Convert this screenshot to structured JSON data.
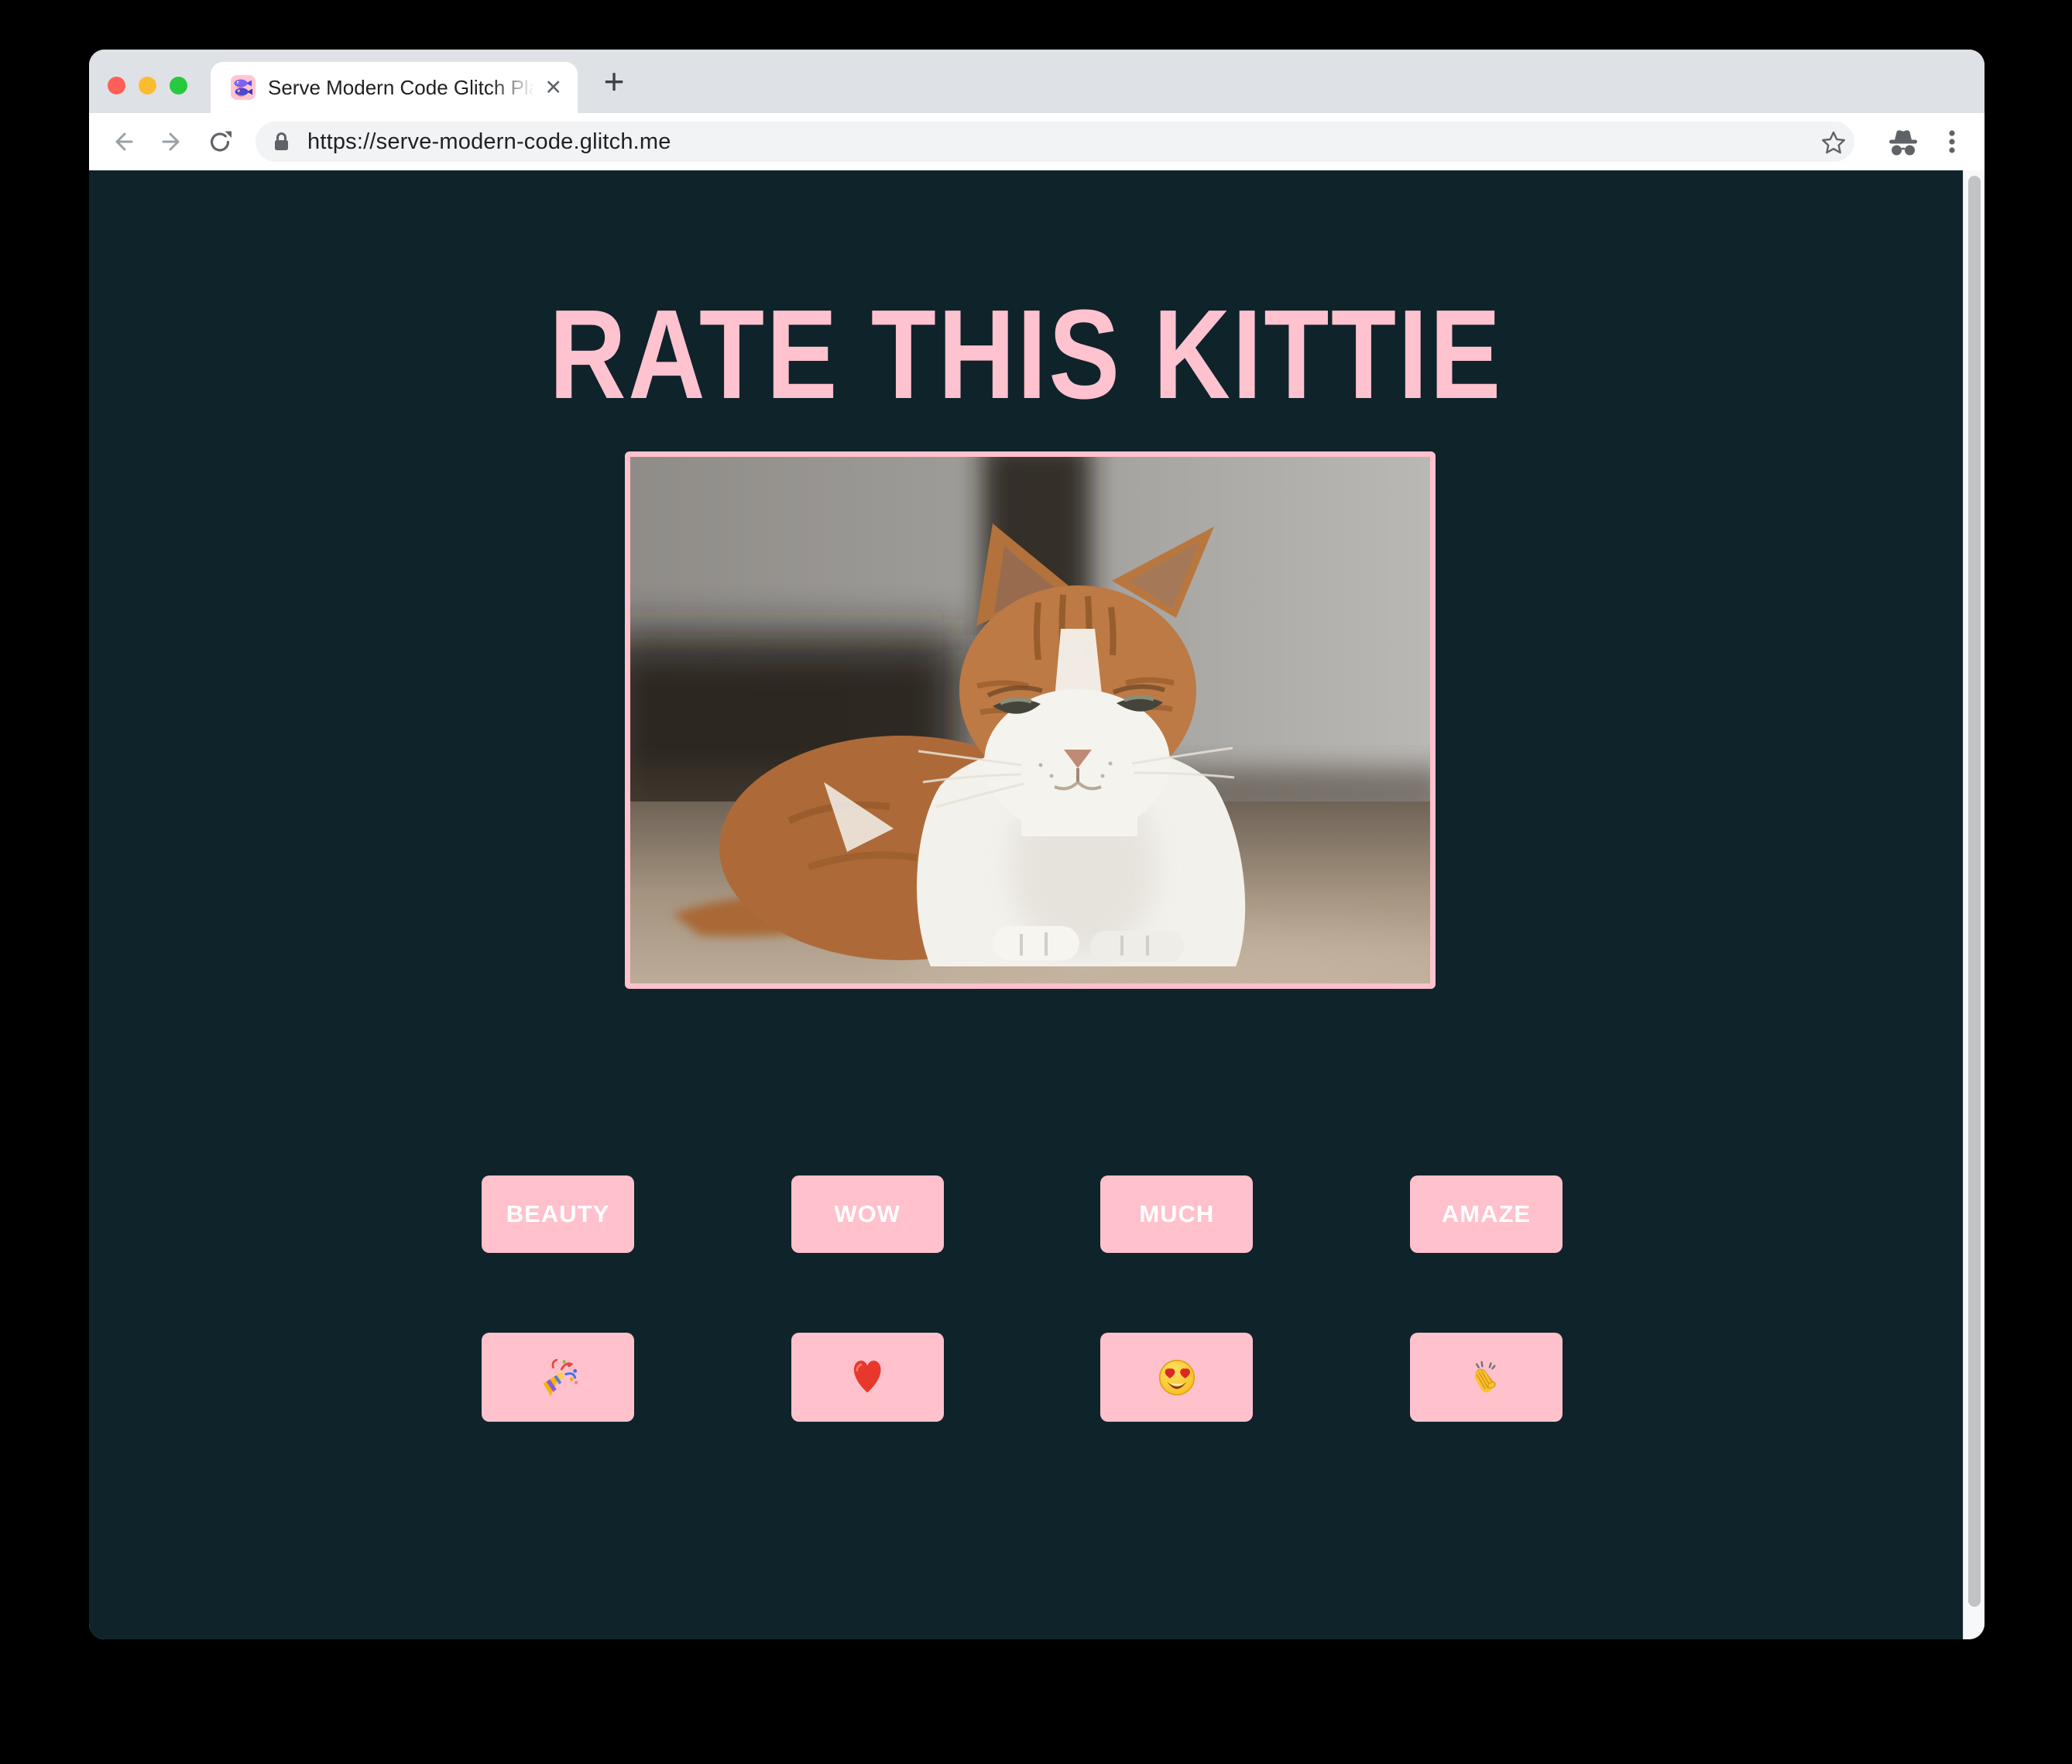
{
  "browser": {
    "tab_title": "Serve Modern Code Glitch Play",
    "close_tab_glyph": "✕",
    "new_tab_glyph": "+",
    "url": "https://serve-modern-code.glitch.me",
    "favicon_name": "glitch-fish-icon",
    "window_buttons": [
      "close",
      "minimize",
      "zoom"
    ]
  },
  "page": {
    "title": "RATE THIS KITTIE",
    "rating_buttons": [
      {
        "label": "BEAUTY"
      },
      {
        "label": "WOW"
      },
      {
        "label": "MUCH"
      },
      {
        "label": "AMAZE"
      }
    ],
    "emoji_buttons": [
      {
        "name": "party-popper",
        "char": "🎉"
      },
      {
        "name": "red-heart",
        "char": "❤️"
      },
      {
        "name": "smiling-face-with-heart-eyes",
        "char": "😍"
      },
      {
        "name": "clapping-hands",
        "char": "👏"
      }
    ],
    "image_description": "orange and white cat lying on the floor"
  },
  "colors": {
    "pink_accent": "#ffc1cc",
    "page_background": "#0f232b",
    "button_text": "#ffffff"
  }
}
